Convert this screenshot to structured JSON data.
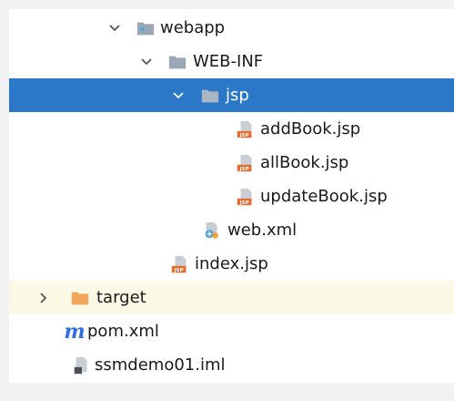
{
  "tree": {
    "rows": [
      {
        "label": "webapp",
        "icon": "web-folder-icon",
        "chevron": "down"
      },
      {
        "label": "WEB-INF",
        "icon": "folder-icon",
        "chevron": "down"
      },
      {
        "label": "jsp",
        "icon": "folder-icon",
        "chevron": "down",
        "selected": true
      },
      {
        "label": "addBook.jsp",
        "icon": "jsp-file-icon"
      },
      {
        "label": "allBook.jsp",
        "icon": "jsp-file-icon"
      },
      {
        "label": "updateBook.jsp",
        "icon": "jsp-file-icon"
      },
      {
        "label": "web.xml",
        "icon": "web-xml-icon"
      },
      {
        "label": "index.jsp",
        "icon": "jsp-file-icon"
      },
      {
        "label": "target",
        "icon": "excluded-folder-icon",
        "chevron": "right",
        "excluded": true
      },
      {
        "label": "pom.xml",
        "icon": "maven-icon",
        "icon_glyph": "m"
      },
      {
        "label": "ssmdemo01.iml",
        "icon": "iml-file-icon"
      }
    ]
  },
  "colors": {
    "selection": "#2a78c7",
    "excluded_row": "#fbf8e6",
    "folder": "#9aa7b4",
    "target_folder": "#f0a75c",
    "jsp_badge": "#e8692e",
    "maven": "#2e6fe0"
  }
}
